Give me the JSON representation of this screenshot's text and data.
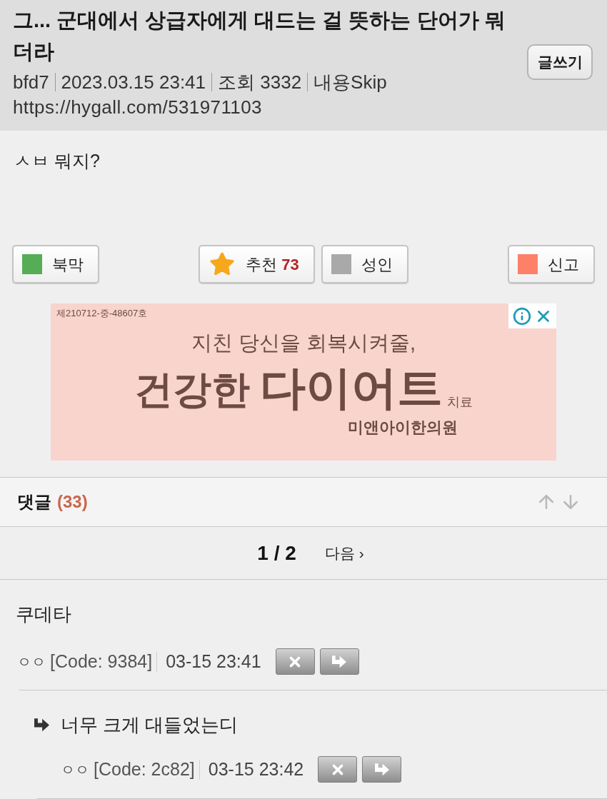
{
  "post": {
    "title": "그... 군대에서 상급자에게 대드는 걸 뜻하는 단어가 뭐더라",
    "write_button": "글쓰기",
    "meta": [
      "bfd7",
      "2023.03.15 23:41",
      "조회 3332",
      "내용Skip"
    ],
    "url": "https://hygall.com/531971103",
    "body": "ㅅㅂ 뭐지?"
  },
  "actions": [
    {
      "kind": "swatch",
      "label": "북막",
      "color": "#55ad55"
    },
    {
      "kind": "star",
      "label": "추천",
      "count": "73"
    },
    {
      "kind": "swatch",
      "label": "성인",
      "color": "#a9a9a9"
    },
    {
      "kind": "swatch",
      "label": "신고",
      "color": "#fd8069"
    }
  ],
  "ad": {
    "registration": "제210712-중-48607호",
    "tagline": "지친 당신을 회복시켜줄,",
    "headline": "건강한",
    "headline_emphasis": "다이어트",
    "headline_suffix": "치료",
    "advertiser": "미앤아이한의원"
  },
  "comments_header": {
    "label": "댓글",
    "count": "(33)"
  },
  "pagination": {
    "page": "1 / 2",
    "next": "다음 ›"
  },
  "comments": [
    {
      "text": "쿠데타",
      "author": "ㅇㅇ",
      "code": "[Code: 9384]",
      "time": "03-15 23:41",
      "children": [
        {
          "text": "너무 크게 대들었는디",
          "author": "ㅇㅇ",
          "code": "[Code: 2c82]",
          "time": "03-15 23:42"
        }
      ]
    }
  ]
}
